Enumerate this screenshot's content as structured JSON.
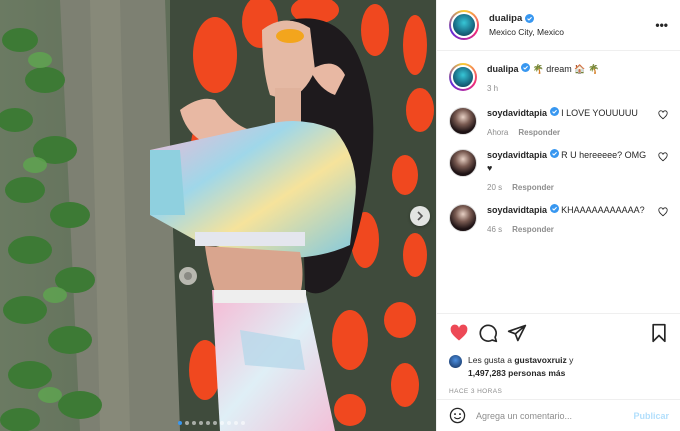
{
  "post": {
    "author": {
      "username": "dualipa",
      "verified": true,
      "location": "Mexico City, Mexico",
      "avatar": "avatar-image"
    },
    "more_icon": "more-horizontal-icon",
    "media": {
      "description_icon": "photo",
      "next_icon": "chevron-right-icon",
      "carousel_count": 10,
      "carousel_active": 0
    },
    "caption": {
      "username": "dualipa",
      "text": "🌴 dream 🏠 🌴",
      "time": "3 h"
    },
    "comments": [
      {
        "username": "soydavidtapia",
        "text": "I LOVE YOUUUUU",
        "time": "Ahora",
        "reply_label": "Responder"
      },
      {
        "username": "soydavidtapia",
        "text": "R U hereeeee? OMG ♥",
        "time": "20 s",
        "reply_label": "Responder"
      },
      {
        "username": "soydavidtapia",
        "text": "KHAAAAAAAAAAA?",
        "time": "46 s",
        "reply_label": "Responder"
      }
    ],
    "actions": {
      "like_icon": "heart-filled-icon",
      "comment_icon": "comment-icon",
      "share_icon": "share-icon",
      "save_icon": "bookmark-icon"
    },
    "likes": {
      "prefix": "Les gusta a",
      "user": "gustavoxruiz",
      "connector": "y",
      "count": "1,497,283 personas más"
    },
    "timestamp": "HACE 3 HORAS",
    "comment_box": {
      "placeholder": "Agrega un comentario...",
      "publish_label": "Publicar",
      "emoji_icon": "smile-icon"
    },
    "colors": {
      "like_red": "#ed4956",
      "verified_blue": "#3897f0",
      "publish_disabled": "#b2dffc",
      "muted": "#8e8e8e"
    }
  }
}
